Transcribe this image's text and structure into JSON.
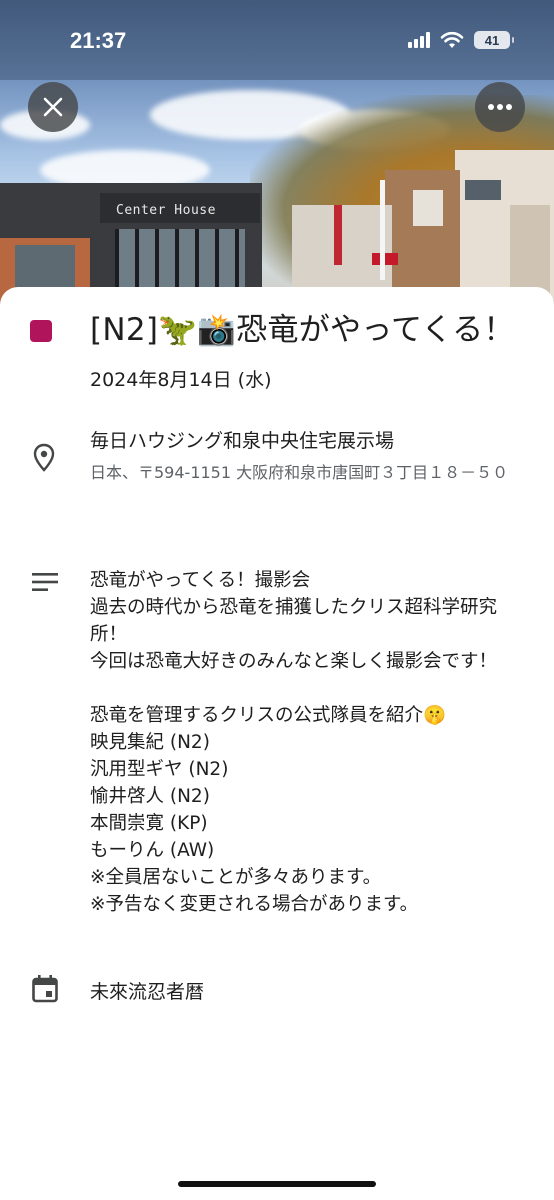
{
  "status_bar": {
    "time": "21:37",
    "battery": "41"
  },
  "hero": {
    "sign_text": "Center House"
  },
  "event": {
    "color": "#b0145a",
    "title": "[N2]🦖📸恐竜がやってくる！",
    "date": "2024年8月14日 (水)",
    "location_name": "毎日ハウジング和泉中央住宅展示場",
    "location_address": "日本、〒594-1151 大阪府和泉市唐国町３丁目１８－５０",
    "description": "恐竜がやってくる！撮影会\n過去の時代から恐竜を捕獲したクリス超科学研究所！\n今回は恐竜大好きのみんなと楽しく撮影会です！\n\n恐竜を管理するクリスの公式隊員を紹介🤫\n映見集紀 (N2)\n汎用型ギヤ (N2)\n愉井啓人 (N2)\n本間崇寛 (KP)\nもーりん (AW)\n※全員居ないことが多々あります。\n※予告なく変更される場合があります。",
    "calendar": "未來流忍者暦"
  },
  "icons": {
    "close": "close-icon",
    "more": "more-horiz-icon",
    "location": "location-pin-icon",
    "description": "notes-icon",
    "calendar": "calendar-icon"
  }
}
